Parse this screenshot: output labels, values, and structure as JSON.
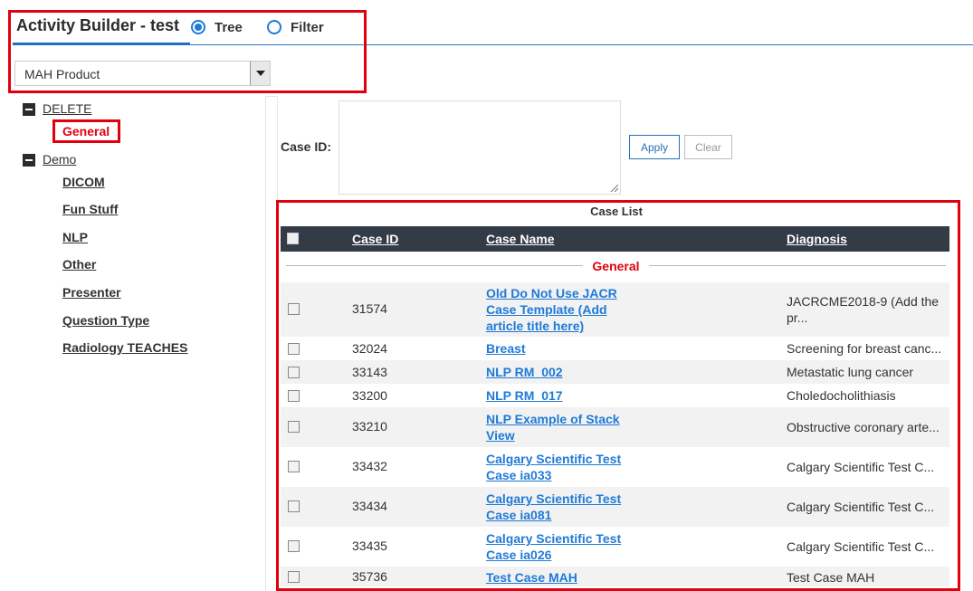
{
  "header": {
    "title": "Activity Builder - test",
    "view_options": [
      {
        "label": "Tree",
        "selected": true
      },
      {
        "label": "Filter",
        "selected": false
      }
    ],
    "product_select": {
      "value": "MAH Product"
    }
  },
  "tree": {
    "nodes": [
      {
        "label": "DELETE",
        "expanded": true,
        "children": [
          {
            "label": "General",
            "selected": true
          }
        ]
      },
      {
        "label": "Demo",
        "expanded": true,
        "children": [
          {
            "label": "DICOM"
          },
          {
            "label": "Fun Stuff"
          },
          {
            "label": "NLP"
          },
          {
            "label": "Other"
          },
          {
            "label": "Presenter"
          },
          {
            "label": "Question Type"
          },
          {
            "label": "Radiology TEACHES"
          }
        ]
      }
    ]
  },
  "filter": {
    "case_id_label": "Case ID:",
    "case_id_value": "",
    "apply_label": "Apply",
    "clear_label": "Clear"
  },
  "case_list": {
    "title": "Case List",
    "columns": [
      "Case ID",
      "Case Name",
      "Diagnosis"
    ],
    "group": "General",
    "rows": [
      {
        "id": "31574",
        "name": "Old Do Not Use JACR Case Template (Add article title here)",
        "diagnosis": "JACRCME2018-9 (Add the pr..."
      },
      {
        "id": "32024",
        "name": "Breast",
        "diagnosis": "Screening for breast canc..."
      },
      {
        "id": "33143",
        "name": "NLP RM_002",
        "diagnosis": "Metastatic lung cancer"
      },
      {
        "id": "33200",
        "name": "NLP RM_017",
        "diagnosis": "Choledocholithiasis"
      },
      {
        "id": "33210",
        "name": "NLP Example of Stack View",
        "diagnosis": "Obstructive coronary arte..."
      },
      {
        "id": "33432",
        "name": "Calgary Scientific Test Case ia033",
        "diagnosis": "Calgary Scientific Test C..."
      },
      {
        "id": "33434",
        "name": "Calgary Scientific Test Case ia081",
        "diagnosis": "Calgary Scientific Test C..."
      },
      {
        "id": "33435",
        "name": "Calgary Scientific Test Case ia026",
        "diagnosis": "Calgary Scientific Test C..."
      },
      {
        "id": "35736",
        "name": "Test Case MAH",
        "diagnosis": "Test Case MAH"
      }
    ]
  },
  "colors": {
    "accent": "#1f7ad8",
    "highlight": "#e2000f",
    "table_header": "#333b47"
  }
}
